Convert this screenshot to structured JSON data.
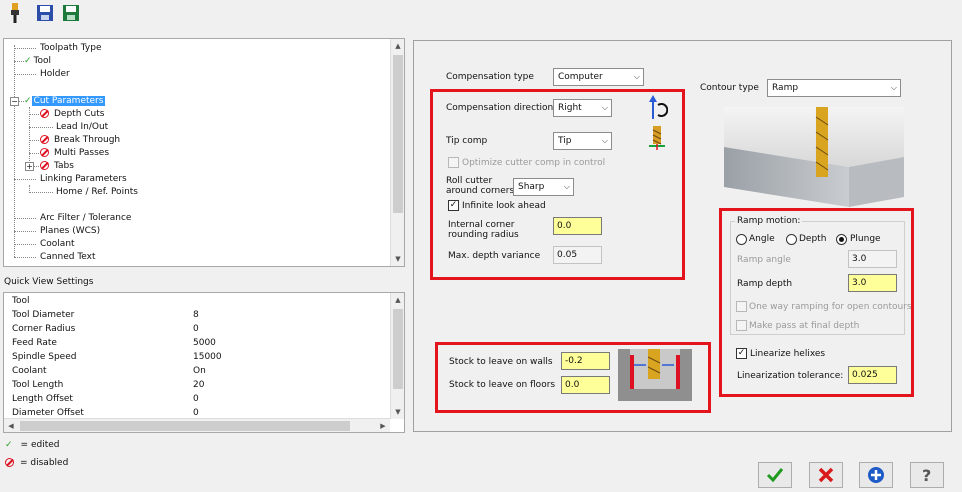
{
  "toolbar": {
    "icons": [
      "tool-holder-icon",
      "save-icon",
      "save-library-icon"
    ]
  },
  "tree": {
    "items": [
      {
        "label": "Toolpath Type",
        "status": "none"
      },
      {
        "label": "Tool",
        "status": "edited"
      },
      {
        "label": "Holder",
        "status": "none"
      },
      {
        "label": "Cut Parameters",
        "status": "edited",
        "selected": true
      },
      {
        "label": "Depth Cuts",
        "status": "disabled"
      },
      {
        "label": "Lead In/Out",
        "status": "none"
      },
      {
        "label": "Break Through",
        "status": "disabled"
      },
      {
        "label": "Multi Passes",
        "status": "disabled"
      },
      {
        "label": "Tabs",
        "status": "disabled"
      },
      {
        "label": "Linking Parameters",
        "status": "none"
      },
      {
        "label": "Home / Ref. Points",
        "status": "none"
      },
      {
        "label": "Arc Filter / Tolerance",
        "status": "none"
      },
      {
        "label": "Planes (WCS)",
        "status": "none"
      },
      {
        "label": "Coolant",
        "status": "none"
      },
      {
        "label": "Canned Text",
        "status": "none"
      }
    ]
  },
  "quick_view": {
    "title": "Quick View Settings",
    "rows": [
      {
        "key": "Tool",
        "value": ""
      },
      {
        "key": "Tool Diameter",
        "value": "8"
      },
      {
        "key": "Corner Radius",
        "value": "0"
      },
      {
        "key": "Feed Rate",
        "value": "5000"
      },
      {
        "key": "Spindle Speed",
        "value": "15000"
      },
      {
        "key": "Coolant",
        "value": "On"
      },
      {
        "key": "Tool Length",
        "value": "20"
      },
      {
        "key": "Length Offset",
        "value": "0"
      },
      {
        "key": "Diameter Offset",
        "value": "0"
      }
    ]
  },
  "legend": {
    "edited": "= edited",
    "disabled": "= disabled"
  },
  "cut_params": {
    "comp_type_label": "Compensation type",
    "comp_type_value": "Computer",
    "comp_dir_label": "Compensation direction",
    "comp_dir_value": "Right",
    "tip_comp_label": "Tip comp",
    "tip_comp_value": "Tip",
    "optimize_label": "Optimize cutter comp in control",
    "roll_label_1": "Roll cutter",
    "roll_label_2": "around corners",
    "roll_value": "Sharp",
    "infinite_label": "Infinite look ahead",
    "internal_corner_label_1": "Internal corner",
    "internal_corner_label_2": "rounding radius",
    "internal_corner_value": "0.0",
    "max_depth_label": "Max. depth variance",
    "max_depth_value": "0.05",
    "contour_type_label": "Contour type",
    "contour_type_value": "Ramp",
    "stock_walls_label": "Stock to leave on walls",
    "stock_walls_value": "-0.2",
    "stock_floors_label": "Stock to leave on floors",
    "stock_floors_value": "0.0"
  },
  "ramp": {
    "group_label": "Ramp motion:",
    "angle_label": "Angle",
    "depth_label": "Depth",
    "plunge_label": "Plunge",
    "ramp_angle_label": "Ramp angle",
    "ramp_angle_value": "3.0",
    "ramp_depth_label": "Ramp depth",
    "ramp_depth_value": "3.0",
    "one_way_label": "One way ramping for open contours",
    "final_depth_label": "Make pass at final depth",
    "linearize_label": "Linearize helixes",
    "lin_tol_label": "Linearization tolerance:",
    "lin_tol_value": "0.025"
  },
  "buttons": {
    "icons": [
      "ok-check-icon",
      "cancel-x-icon",
      "add-plus-icon",
      "help-question-icon"
    ]
  },
  "colors": {
    "highlight_red": "#e3141b",
    "selection_blue": "#3399ff",
    "input_yellow": "#ffff99"
  }
}
